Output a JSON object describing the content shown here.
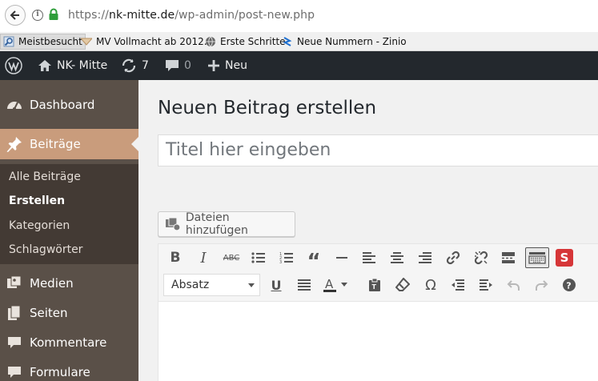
{
  "browser": {
    "url_prefix": "https://",
    "url_host": "nk-mitte.de",
    "url_path": "/wp-admin/post-new.php"
  },
  "bookmarks": [
    {
      "label": "Meistbesucht",
      "icon": "magnifier-icon"
    },
    {
      "label": "MV Vollmacht ab 2012...",
      "icon": "envelope-icon"
    },
    {
      "label": "Erste Schritte",
      "icon": "globe-icon"
    },
    {
      "label": "Neue Nummern - Zinio",
      "icon": "zinio-icon"
    }
  ],
  "adminbar": {
    "site_name": "NK- Mitte",
    "updates_count": "7",
    "comments_count": "0",
    "new_label": "Neu"
  },
  "sidebar": {
    "dashboard": "Dashboard",
    "posts": "Beiträge",
    "submenu": [
      "Alle Beiträge",
      "Erstellen",
      "Kategorien",
      "Schlagwörter"
    ],
    "media": "Medien",
    "pages": "Seiten",
    "comments": "Kommentare",
    "forms": "Formulare"
  },
  "main": {
    "page_title": "Neuen Beitrag erstellen",
    "title_placeholder": "Titel hier eingeben",
    "add_media": "Dateien hinzufügen",
    "format_select": "Absatz"
  },
  "colors": {
    "sidebar_bg": "#5a5048",
    "active_item": "#c99c7c",
    "submenu_bg": "#433a34",
    "adminbar_bg": "#23282d",
    "accent_red": "#d63638"
  }
}
